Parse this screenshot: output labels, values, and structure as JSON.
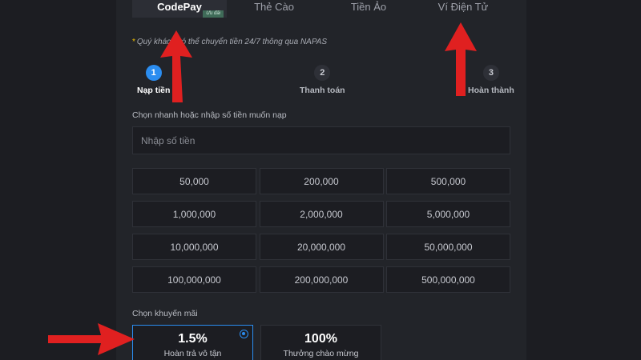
{
  "tabs": [
    {
      "label": "CodePay",
      "badge": "Ưu đãi",
      "active": true
    },
    {
      "label": "Thẻ Cào",
      "active": false
    },
    {
      "label": "Tiền Ảo",
      "active": false
    },
    {
      "label": "Ví Điện Tử",
      "active": false
    }
  ],
  "notice": {
    "star": "*",
    "text": "Quý khách có thể chuyển tiền 24/7 thông qua NAPAS"
  },
  "steps": [
    {
      "number": "1",
      "label": "Nạp tiền",
      "active": true
    },
    {
      "number": "2",
      "label": "Thanh toán",
      "active": false
    },
    {
      "number": "3",
      "label": "Hoàn thành",
      "active": false
    }
  ],
  "amount": {
    "label": "Chọn nhanh hoặc nhập số tiền muốn nạp",
    "placeholder": "Nhập số tiền",
    "options": [
      "50,000",
      "200,000",
      "500,000",
      "1,000,000",
      "2,000,000",
      "5,000,000",
      "10,000,000",
      "20,000,000",
      "50,000,000",
      "100,000,000",
      "200,000,000",
      "500,000,000"
    ]
  },
  "promo": {
    "label": "Chọn khuyến mãi",
    "options": [
      {
        "value": "1.5%",
        "desc": "Hoàn trả vô tận",
        "selected": true
      },
      {
        "value": "100%",
        "desc": "Thưởng chào mừng",
        "selected": false
      }
    ]
  },
  "colors": {
    "accent": "#2b8df0",
    "arrow": "#e02020",
    "background": "#1c1d22",
    "panel": "#222429"
  }
}
